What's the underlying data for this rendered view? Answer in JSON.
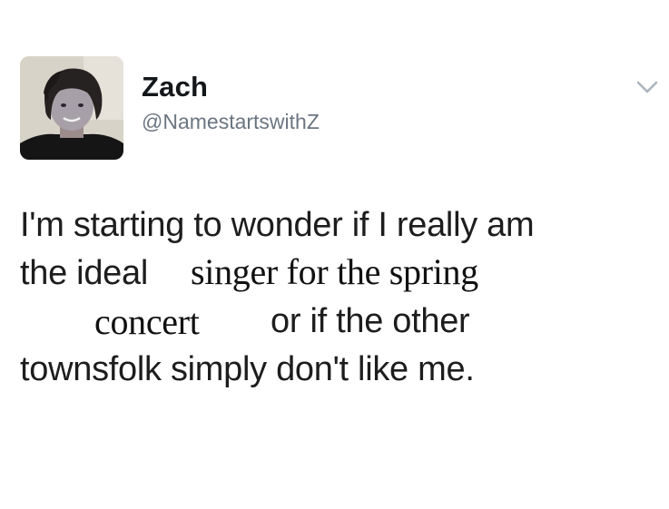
{
  "user": {
    "display_name": "Zach",
    "handle": "@NamestartswithZ",
    "avatar_icon": "profile-photo"
  },
  "menu": {
    "icon": "chevron-down-icon"
  },
  "tweet": {
    "line1": "I'm starting to wonder if I really am",
    "line2_start": "the ideal",
    "line2_edit": "singer for the spring",
    "line3_edit": "concert",
    "line3_rest": "or if the other",
    "line4": "townsfolk simply don't like me."
  },
  "colors": {
    "name": "#14171a",
    "handle": "#6b7682",
    "text": "#1d1d1d",
    "chevron": "#aab4bd"
  }
}
